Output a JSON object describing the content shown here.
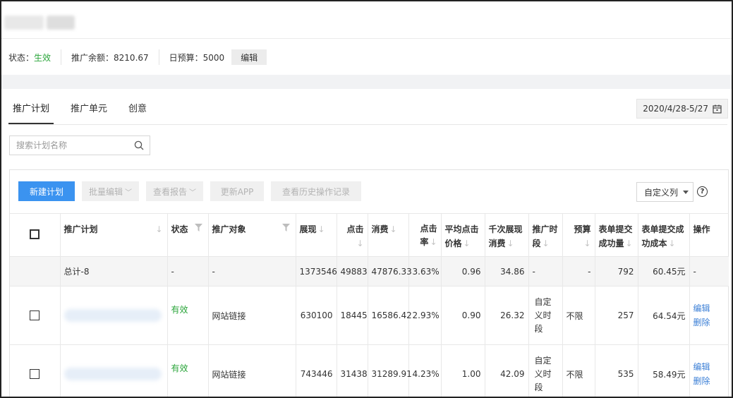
{
  "account": {
    "status_label": "状态：",
    "status_value": "生效",
    "balance": "推广余额：8210.67",
    "daily_budget": "日预算：5000",
    "edit_label": "编辑"
  },
  "tabs": [
    {
      "label": "推广计划",
      "active": true
    },
    {
      "label": "推广单元",
      "active": false
    },
    {
      "label": "创意",
      "active": false
    }
  ],
  "date_range": "2020/4/28-5/27",
  "search": {
    "placeholder": "搜索计划名称"
  },
  "toolbar": {
    "new_plan": "新建计划",
    "bulk_edit": "批量编辑",
    "view_report": "查看报告",
    "update_app": "更新APP",
    "history": "查看历史操作记录",
    "custom_columns": "自定义列",
    "help": "?"
  },
  "table": {
    "headers": {
      "plan": "推广计划",
      "status": "状态",
      "target": "推广对象",
      "impressions": "展现",
      "clicks": "点击",
      "cost": "消费",
      "ctr": "点击率",
      "avg_cpc": "平均点击价格",
      "cpm": "千次展现消费",
      "schedule": "推广时段",
      "budget": "预算",
      "forms": "表单提交成功量",
      "form_cost": "表单提交成功成本",
      "actions": "操作"
    },
    "total": {
      "plan": "总计-8",
      "status": "-",
      "target": "-",
      "impressions": "1373546",
      "clicks": "49883",
      "cost": "47876.33",
      "ctr": "3.63%",
      "avg_cpc": "0.96",
      "cpm": "34.86",
      "schedule": "-",
      "budget": "-",
      "forms": "792",
      "form_cost": "60.45元",
      "actions": "-"
    },
    "rows": [
      {
        "status": "有效",
        "target": "网站链接",
        "impressions": "630100",
        "clicks": "18445",
        "cost": "16586.42",
        "ctr": "2.93%",
        "avg_cpc": "0.90",
        "cpm": "26.32",
        "schedule": "自定义时段",
        "budget": "不限",
        "forms": "257",
        "form_cost": "64.54元",
        "edit": "编辑",
        "delete": "删除"
      },
      {
        "status": "有效",
        "target": "网站链接",
        "impressions": "743446",
        "clicks": "31438",
        "cost": "31289.91",
        "ctr": "4.23%",
        "avg_cpc": "1.00",
        "cpm": "42.09",
        "schedule": "自定义时段",
        "budget": "不限",
        "forms": "535",
        "form_cost": "58.49元",
        "edit": "编辑",
        "delete": "删除"
      }
    ]
  },
  "colors": {
    "accent": "#3b93f0",
    "status_green": "#2aa53a",
    "link": "#3b7fd6"
  }
}
